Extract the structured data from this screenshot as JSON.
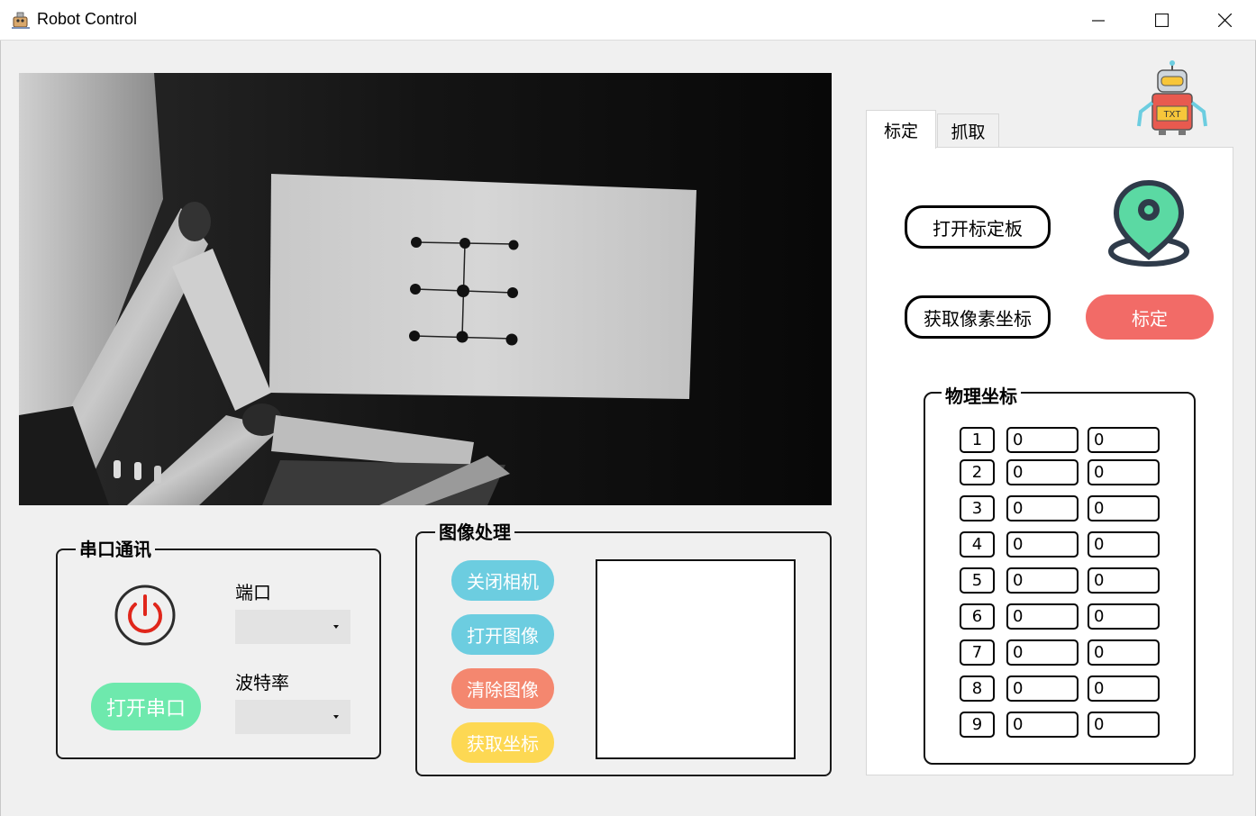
{
  "window": {
    "title": "Robot Control"
  },
  "serial": {
    "group_title": "串口通讯",
    "port_label": "端口",
    "port_value": "",
    "baud_label": "波特率",
    "baud_value": "",
    "open_button": "打开串口",
    "power_icon": "power-icon"
  },
  "image": {
    "group_title": "图像处理",
    "buttons": [
      "关闭相机",
      "打开图像",
      "清除图像",
      "获取坐标"
    ]
  },
  "tabs": [
    "标定",
    "抓取"
  ],
  "calib": {
    "open_board": "打开标定板",
    "get_pixel": "获取像素坐标",
    "calibrate": "标定",
    "location_icon": "location-pin-icon"
  },
  "physical": {
    "title": "物理坐标",
    "rows": [
      {
        "n": "1",
        "x": "0",
        "y": "0"
      },
      {
        "n": "2",
        "x": "0",
        "y": "0"
      },
      {
        "n": "3",
        "x": "0",
        "y": "0"
      },
      {
        "n": "4",
        "x": "0",
        "y": "0"
      },
      {
        "n": "5",
        "x": "0",
        "y": "0"
      },
      {
        "n": "6",
        "x": "0",
        "y": "0"
      },
      {
        "n": "7",
        "x": "0",
        "y": "0"
      },
      {
        "n": "8",
        "x": "0",
        "y": "0"
      },
      {
        "n": "9",
        "x": "0",
        "y": "0"
      }
    ]
  },
  "colors": {
    "btn_blue": "#6ccde0",
    "btn_salmon": "#f4876f",
    "btn_yellow": "#fdd853",
    "btn_green": "#6ee9ad",
    "btn_red": "#f26b67"
  }
}
